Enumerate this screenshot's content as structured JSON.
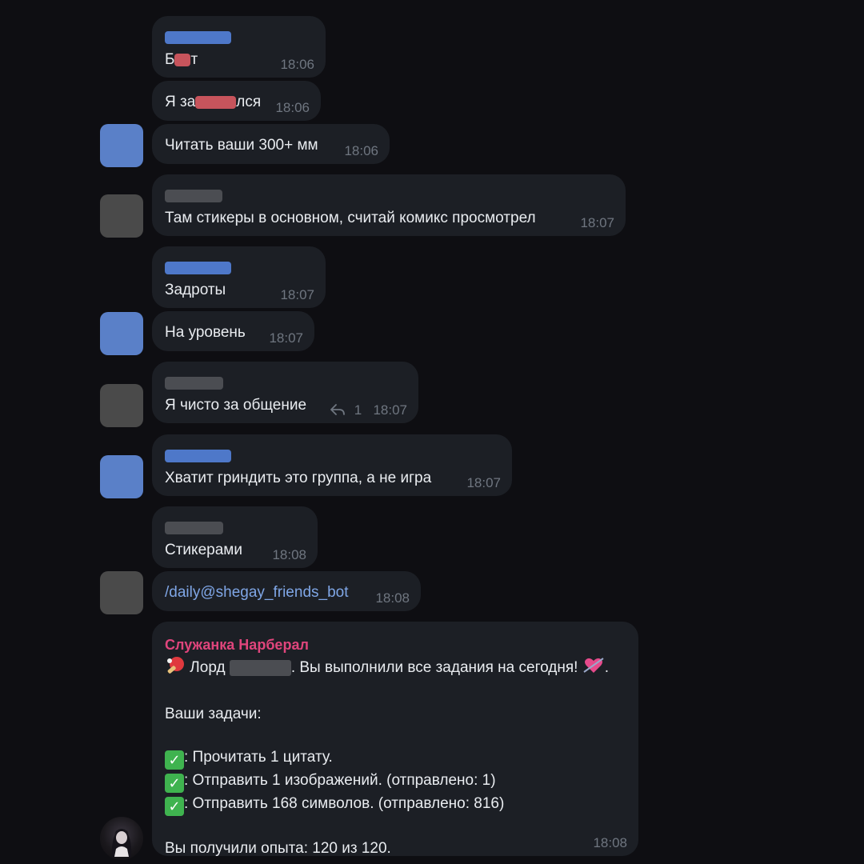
{
  "messages": {
    "m1": {
      "text_pre": "Б",
      "text_post": "т",
      "time": "18:06"
    },
    "m2": {
      "text_pre": "Я за",
      "text_post": "лся",
      "time": "18:06"
    },
    "m3": {
      "text": "Читать ваши 300+ мм",
      "time": "18:06"
    },
    "m4": {
      "text": "Там стикеры в основном, считай комикс просмотрел",
      "time": "18:07"
    },
    "m5": {
      "text": "Задроты",
      "time": "18:07"
    },
    "m6": {
      "text": "На уровень",
      "time": "18:07"
    },
    "m7": {
      "text": "Я чисто за общение",
      "replies": "1",
      "time": "18:07"
    },
    "m8": {
      "text": "Хватит гриндить это группа, а не игра",
      "time": "18:07"
    },
    "m9": {
      "text": "Стикерами",
      "time": "18:08"
    },
    "m10": {
      "text": "/daily@shegay_friends_bot",
      "time": "18:08"
    },
    "bot": {
      "sender": "Служанка Нарберал",
      "line1_pre": "Лорд",
      "line1_post": ". Вы выполнили все задания на сегодня!",
      "tasks_title": "Ваши задачи:",
      "task1": ": Прочитать 1 цитату.",
      "task2": ": Отправить 1 изображений. (отправлено: 1)",
      "task3": ": Отправить 168 символов. (отправлено: 816)",
      "xp": "Вы получили опыта: 120 из 120.",
      "time": "18:08"
    }
  },
  "colors": {
    "background": "#0e0e12",
    "bubble": "#1c1f25",
    "sender_name": "#e0457c",
    "link": "#7fa6e6",
    "time": "#6f7680",
    "check": "#3fb34f"
  },
  "icons": {
    "reply": "reply-arrow-icon",
    "ping_pong": "ping-pong-icon",
    "heart": "heart-arrow-icon",
    "check": "check-mark-icon"
  }
}
